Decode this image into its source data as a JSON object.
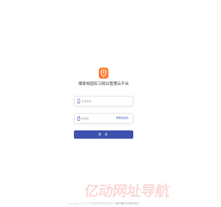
{
  "app": {
    "title": "楼家校园实习就业管理云平台"
  },
  "login_form": {
    "phone_placeholder": "手机号码",
    "code_placeholder": "验证码",
    "get_code_label": "获取验证码",
    "login_button_label": "登 录"
  },
  "footer": {
    "copyright_text": "Copyright © 2021 杭州楼家教育科技有限公司",
    "icp_text": "浙ICP备19016628号-1"
  },
  "watermark": {
    "text": "亿动网址导航"
  },
  "icons": {
    "logo": "location-pin-icon",
    "phone": "mobile-phone-icon",
    "code": "lock-icon"
  },
  "colors": {
    "brand_orange": "#ff7a33",
    "primary_blue": "#3d51ae",
    "link_blue": "#4358b8",
    "watermark_red": "#e64e4e"
  }
}
